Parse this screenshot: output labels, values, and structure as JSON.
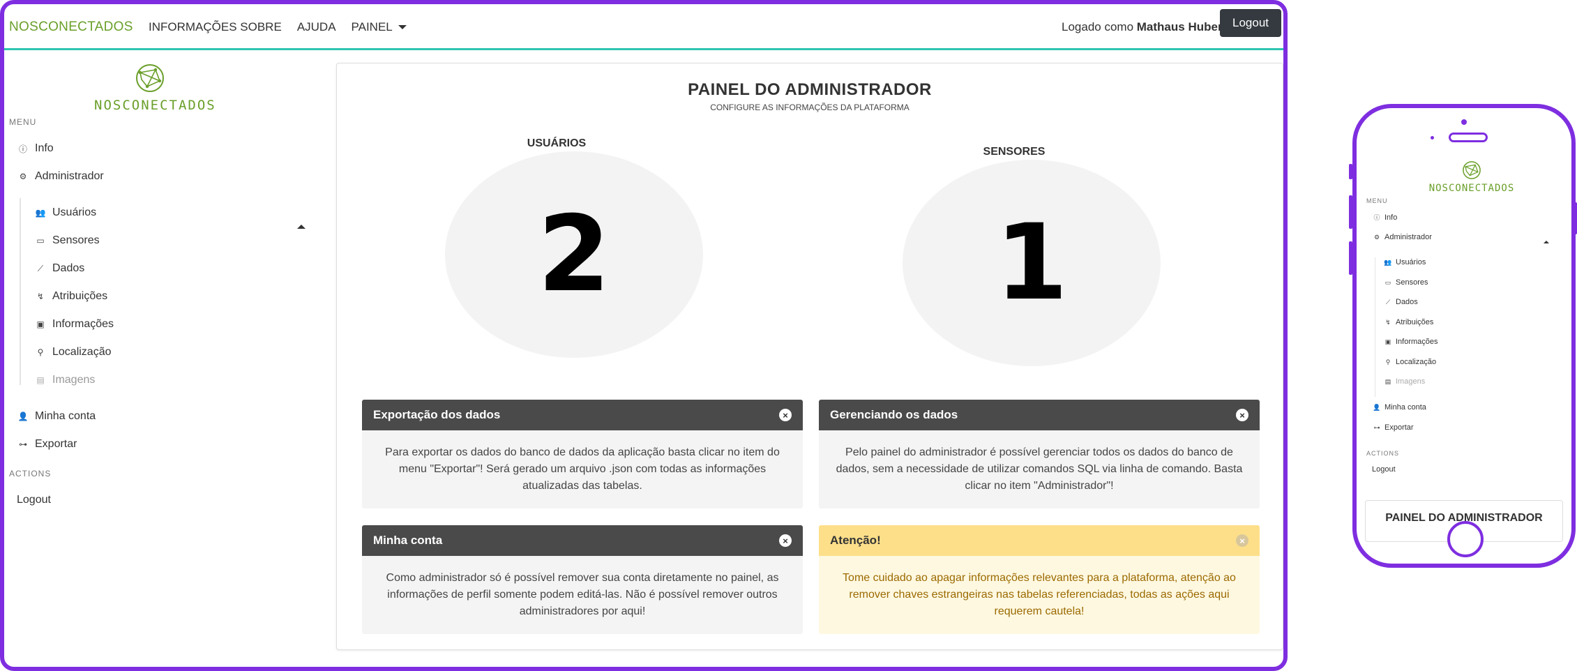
{
  "navbar": {
    "brand": "NOSCONECTADOS",
    "links": [
      "INFORMAÇÕES SOBRE",
      "AJUDA",
      "PAINEL"
    ],
    "logged_prefix": "Logado como",
    "user_name": "Mathaus Huber",
    "logout_label": "Logout"
  },
  "sidebar": {
    "logo_text": "NOSCONECTADOS",
    "menu_label": "MENU",
    "items": [
      {
        "label": "Info",
        "icon": "info-icon"
      },
      {
        "label": "Administrador",
        "icon": "gear-icon"
      }
    ],
    "sub_items": [
      {
        "label": "Usuários",
        "icon": "users-icon"
      },
      {
        "label": "Sensores",
        "icon": "devices-icon"
      },
      {
        "label": "Dados",
        "icon": "chart-icon"
      },
      {
        "label": "Atribuições",
        "icon": "assign-icon"
      },
      {
        "label": "Informações",
        "icon": "info-card-icon"
      },
      {
        "label": "Localização",
        "icon": "location-icon"
      },
      {
        "label": "Imagens",
        "icon": "images-icon"
      }
    ],
    "bottom_items": [
      {
        "label": "Minha conta",
        "icon": "person-icon"
      },
      {
        "label": "Exportar",
        "icon": "link-icon"
      }
    ],
    "actions_label": "ACTIONS",
    "actions_logout": "Logout"
  },
  "main": {
    "title": "PAINEL DO ADMINISTRADOR",
    "subtitle": "CONFIGURE AS INFORMAÇÕES DA PLATAFORMA",
    "stats": [
      {
        "label": "USUÁRIOS",
        "value": "2"
      },
      {
        "label": "SENSORES",
        "value": "1"
      }
    ],
    "cards": [
      {
        "title": "Exportação dos dados",
        "body": "Para exportar os dados do banco de dados da aplicação basta clicar no item do menu \"Exportar\"! Será gerado um arquivo .json com todas as informações atualizadas das tabelas."
      },
      {
        "title": "Gerenciando os dados",
        "body": "Pelo painel do administrador é possível gerenciar todos os dados do banco de dados, sem a necessidade de utilizar comandos SQL via linha de comando. Basta clicar no item \"Administrador\"!"
      },
      {
        "title": "Minha conta",
        "body": "Como administrador só é possível remover sua conta diretamente no painel, as informações de perfil somente podem editá-las. Não é possível remover outros administradores por aqui!"
      },
      {
        "title": "Atenção!",
        "body": "Tome cuidado ao apagar informações relevantes para a plataforma, atenção ao remover chaves estrangeiras nas tabelas referenciadas, todas as ações aqui requerem cautela!"
      }
    ],
    "close_glyph": "×"
  },
  "mobile": {
    "logo_text": "NOSCONECTADOS",
    "menu_label": "MENU",
    "items": [
      "Info",
      "Administrador"
    ],
    "sub_items": [
      "Usuários",
      "Sensores",
      "Dados",
      "Atribuições",
      "Informações",
      "Localização",
      "Imagens"
    ],
    "bottom_items": [
      "Minha conta",
      "Exportar"
    ],
    "actions_label": "ACTIONS",
    "actions_logout": "Logout",
    "panel_title": "PAINEL DO ADMINISTRADOR"
  },
  "colors": {
    "accent_purple": "#7e2ee0",
    "brand_green": "#6a9f2a",
    "navbar_border_teal": "#2ec4b0",
    "dark_button": "#343a40",
    "card_header": "#4a4a4a",
    "warning_header": "#fddf8a",
    "warning_body": "#fff8e1"
  }
}
